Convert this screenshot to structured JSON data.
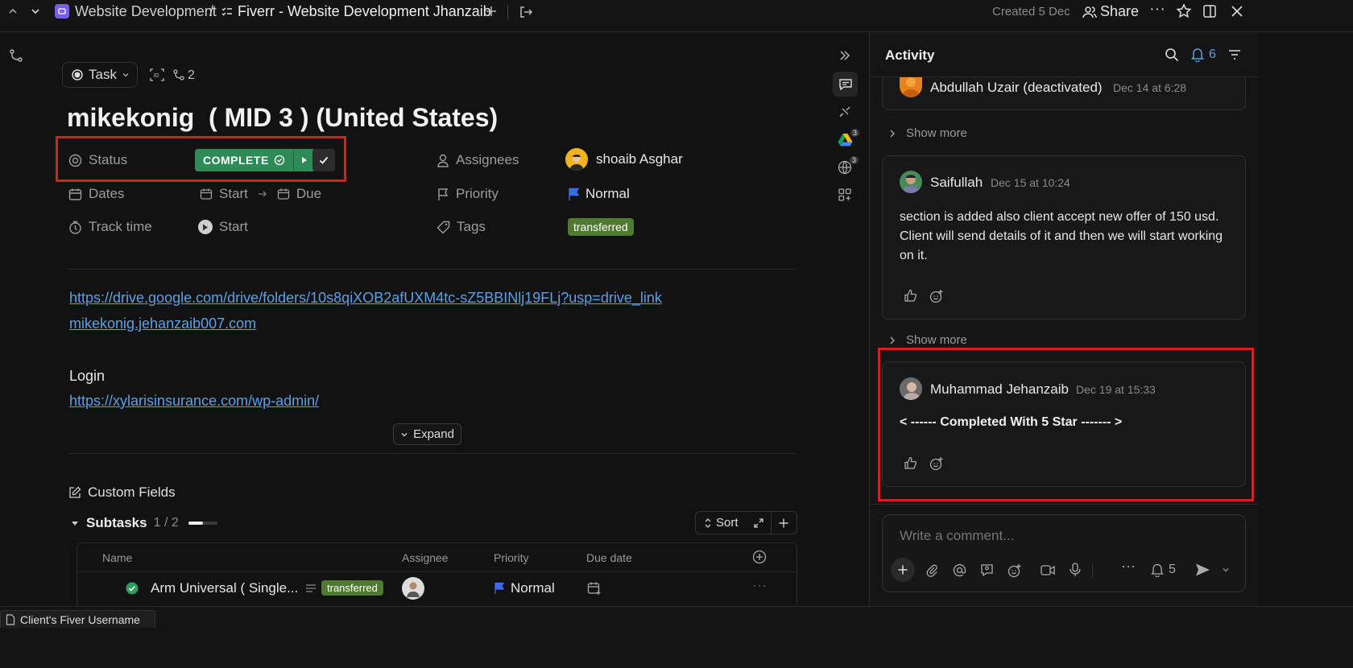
{
  "topbar": {
    "space": "Website Development",
    "separator": "/",
    "list": "Fiverr - Website Development Jhanzaib",
    "created": "Created 5 Dec",
    "share": "Share"
  },
  "task": {
    "type_label": "Task",
    "relations_count": "2",
    "title": "mikekonig  ( MID 3 ) (United States)",
    "status_label": "Status",
    "status_value": "COMPLETE",
    "dates_label": "Dates",
    "start_label": "Start",
    "due_label": "Due",
    "track_label": "Track time",
    "track_start": "Start",
    "assignees_label": "Assignees",
    "assignee": "shoaib Asghar",
    "priority_label": "Priority",
    "priority_value": "Normal",
    "tags_label": "Tags",
    "tag_value": "transferred",
    "colors": {
      "status": "#2e8b57",
      "tag": "#4f7a30",
      "link": "#5aa0e8",
      "flag": "#3b6cf0"
    }
  },
  "description": {
    "link1": "https://drive.google.com/drive/folders/10s8qiXOB2afUXM4tc-sZ5BBINlj19FLj?usp=drive_link",
    "link2": "mikekonig.jehanzaib007.com",
    "login_heading": "Login",
    "link3": "https://xylarisinsurance.com/wp-admin/",
    "expand": "Expand"
  },
  "custom_fields": "Custom Fields",
  "subtasks": {
    "label": "Subtasks",
    "count": "1 / 2",
    "sort": "Sort",
    "columns": [
      "Name",
      "Assignee",
      "Priority",
      "Due date"
    ],
    "rows": [
      {
        "name": "Arm Universal ( Single...",
        "tag": "transferred",
        "priority": "Normal"
      }
    ]
  },
  "bottom_tab": "Client's Fiver Username",
  "activity": {
    "title": "Activity",
    "notif_count": "6",
    "show_more": "Show more",
    "entries": [
      {
        "user": "Abdullah Uzair (deactivated)",
        "time": "Dec 14 at 6:28"
      },
      {
        "user": "Saifullah",
        "time": "Dec 15 at 10:24",
        "text": "section is added also client accept new offer of 150 usd. Client will send details of it and then we will start working on it."
      },
      {
        "user": "Muhammad Jehanzaib",
        "time": "Dec 19 at 15:33",
        "text": "< ------ Completed With 5 Star ------- >"
      }
    ],
    "comment_placeholder": "Write a comment...",
    "watchers": "5"
  },
  "side_badges": {
    "drive": "3",
    "web": "3"
  }
}
